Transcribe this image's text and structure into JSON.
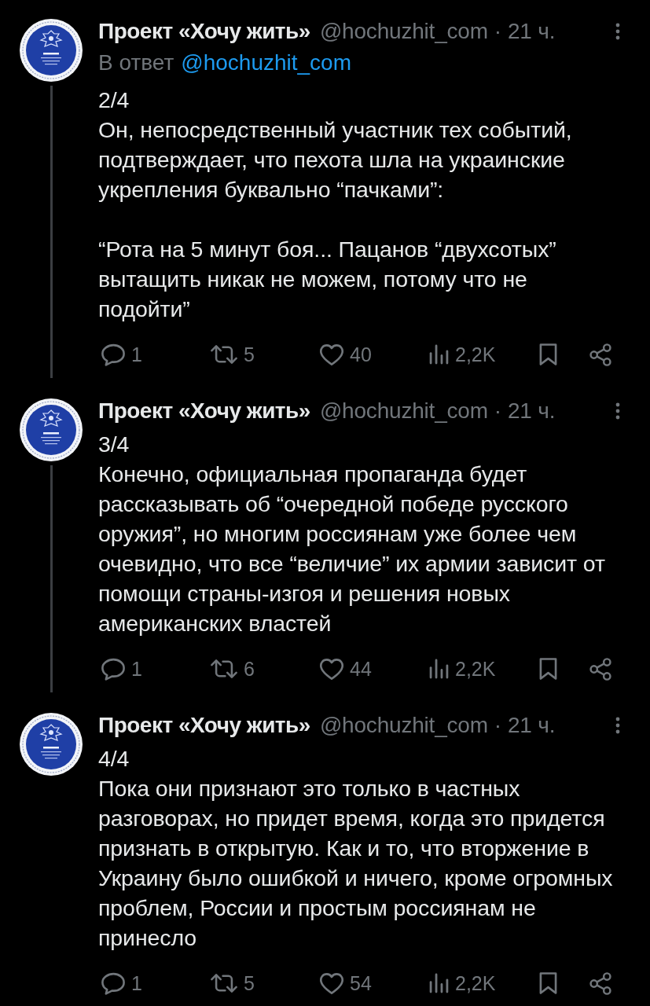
{
  "posts": [
    {
      "author": "Проект «Хочу жить»",
      "handle": "@hochuzhit_com",
      "separator": "·",
      "time": "21 ч.",
      "thread_continues": true,
      "reply_to": {
        "label": "В ответ",
        "handle": "@hochuzhit_com"
      },
      "text": "2/4\nОн, непосредственный участник тех событий, подтверждает, что пехота шла на украинские укрепления буквально “пачками”:\n\n“Рота на 5 минут боя... Пацанов “двухсотых” вытащить никак не можем, потому что не подойти”",
      "actions": [
        {
          "kind": "reply",
          "count": "1"
        },
        {
          "kind": "repost",
          "count": "5"
        },
        {
          "kind": "like",
          "count": "40"
        },
        {
          "kind": "views",
          "count": "2,2K"
        },
        {
          "kind": "bookmark"
        },
        {
          "kind": "share"
        }
      ]
    },
    {
      "author": "Проект «Хочу жить»",
      "handle": "@hochuzhit_com",
      "separator": "·",
      "time": "21 ч.",
      "thread_continues": true,
      "text": "3/4\nКонечно, официальная пропаганда будет рассказывать об “очередной победе русского оружия”, но многим россиянам уже более чем очевидно, что все “величие” их армии зависит от помощи страны-изгоя и решения новых американских властей",
      "actions": [
        {
          "kind": "reply",
          "count": "1"
        },
        {
          "kind": "repost",
          "count": "6"
        },
        {
          "kind": "like",
          "count": "44"
        },
        {
          "kind": "views",
          "count": "2,2K"
        },
        {
          "kind": "bookmark"
        },
        {
          "kind": "share"
        }
      ]
    },
    {
      "author": "Проект «Хочу жить»",
      "handle": "@hochuzhit_com",
      "separator": "·",
      "time": "21 ч.",
      "thread_continues": false,
      "text": "4/4\nПока они признают это только в частных разговорах, но придет время, когда это придется признать в открытую. Как и то, что вторжение в Украину было ошибкой и ничего, кроме огромных проблем, России и простым россиянам не принесло",
      "actions": [
        {
          "kind": "reply",
          "count": "1"
        },
        {
          "kind": "repost",
          "count": "5"
        },
        {
          "kind": "like",
          "count": "54"
        },
        {
          "kind": "views",
          "count": "2,2K"
        },
        {
          "kind": "bookmark"
        },
        {
          "kind": "share"
        }
      ]
    }
  ]
}
